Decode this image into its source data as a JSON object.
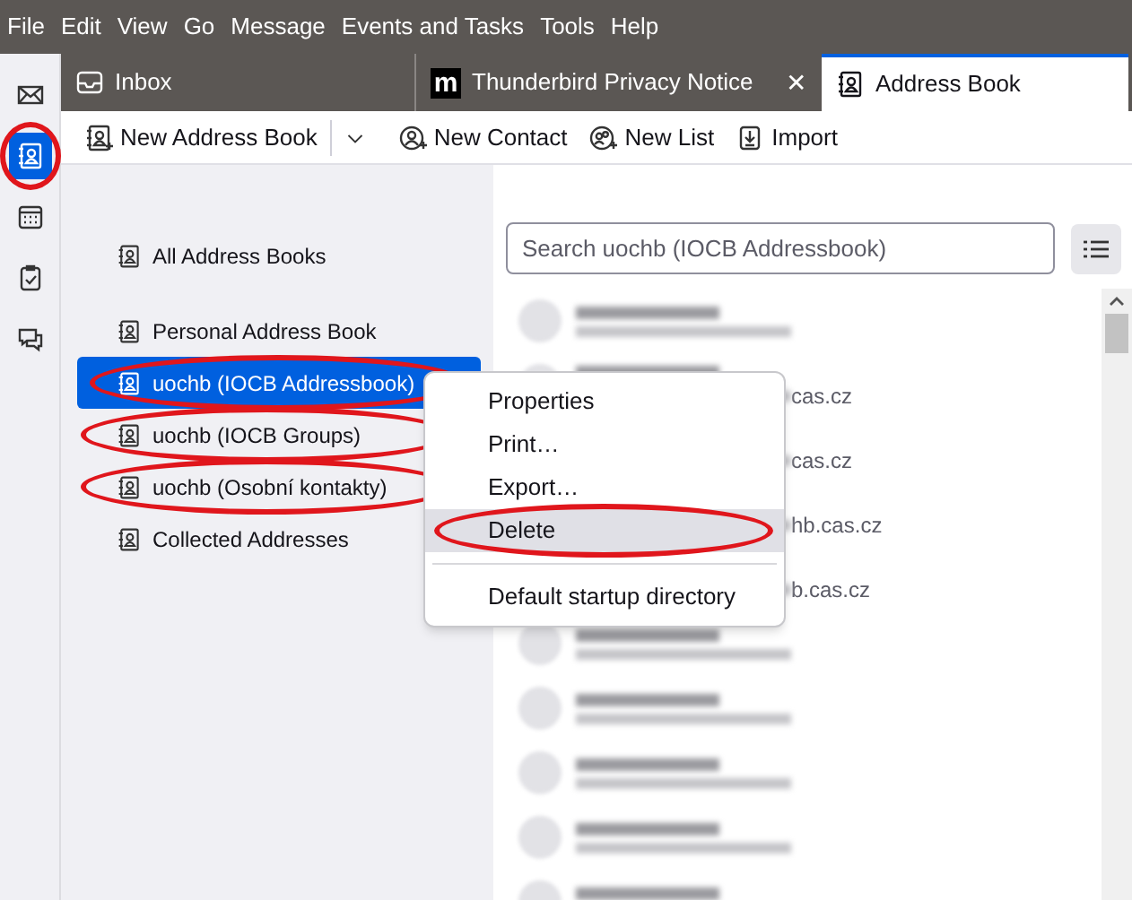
{
  "menu_bar": [
    "File",
    "Edit",
    "View",
    "Go",
    "Message",
    "Events and Tasks",
    "Tools",
    "Help"
  ],
  "spaces": [
    {
      "kind": "mail",
      "selected": false,
      "circled": false
    },
    {
      "kind": "addressbook",
      "selected": true,
      "circled": true
    },
    {
      "kind": "calendar",
      "selected": false,
      "circled": false
    },
    {
      "kind": "tasks",
      "selected": false,
      "circled": false
    },
    {
      "kind": "chat",
      "selected": false,
      "circled": false
    }
  ],
  "tabs": [
    {
      "kind": "inbox",
      "label": "Inbox",
      "selected": false,
      "closable": false
    },
    {
      "kind": "web",
      "logo": "m",
      "label": "Thunderbird Privacy Notice",
      "selected": false,
      "closable": true,
      "close": "✕"
    },
    {
      "kind": "addressbook",
      "label": "Address Book",
      "selected": true,
      "closable": false
    }
  ],
  "toolbar": [
    {
      "kind": "book",
      "label": "New Address Book"
    },
    {
      "kind": "menu_caret"
    },
    {
      "kind": "contact",
      "label": "New Contact"
    },
    {
      "kind": "list",
      "label": "New List"
    },
    {
      "kind": "import",
      "label": "Import"
    }
  ],
  "sidebar": {
    "items": [
      {
        "label": "All Address Books",
        "selected": false,
        "circled": false
      },
      {
        "label": "Personal Address Book",
        "selected": false,
        "circled": false
      },
      {
        "label": "uochb (IOCB Addressbook)",
        "selected": true,
        "circled": true
      },
      {
        "label": "uochb (IOCB Groups)",
        "selected": false,
        "circled": true
      },
      {
        "label": "uochb (Osobní kontakty)",
        "selected": false,
        "circled": true
      },
      {
        "label": "Collected Addresses",
        "selected": false,
        "circled": false
      }
    ]
  },
  "search": {
    "placeholder": "Search uochb (IOCB Addressbook)"
  },
  "contacts": [
    {
      "kind": "blurred"
    },
    {
      "kind": "partly_hidden",
      "email_fragment": "cas.cz"
    },
    {
      "kind": "partly_hidden",
      "email_fragment": "cas.cz"
    },
    {
      "kind": "partly_hidden",
      "email_fragment": "hb.cas.cz"
    },
    {
      "kind": "partly_hidden",
      "email_fragment": "b.cas.cz"
    },
    {
      "kind": "blurred"
    },
    {
      "kind": "blurred"
    },
    {
      "kind": "blurred"
    },
    {
      "kind": "blurred"
    },
    {
      "kind": "blurred"
    }
  ],
  "context_menu": {
    "items": [
      {
        "label": "Properties",
        "highlighted": false,
        "circled": false
      },
      {
        "label": "Print…",
        "highlighted": false,
        "circled": false
      },
      {
        "label": "Export…",
        "highlighted": false,
        "circled": false
      },
      {
        "label": "Delete",
        "highlighted": true,
        "circled": true
      },
      {
        "kind": "separator"
      },
      {
        "label": "Default startup directory",
        "highlighted": false,
        "circled": false
      }
    ]
  }
}
